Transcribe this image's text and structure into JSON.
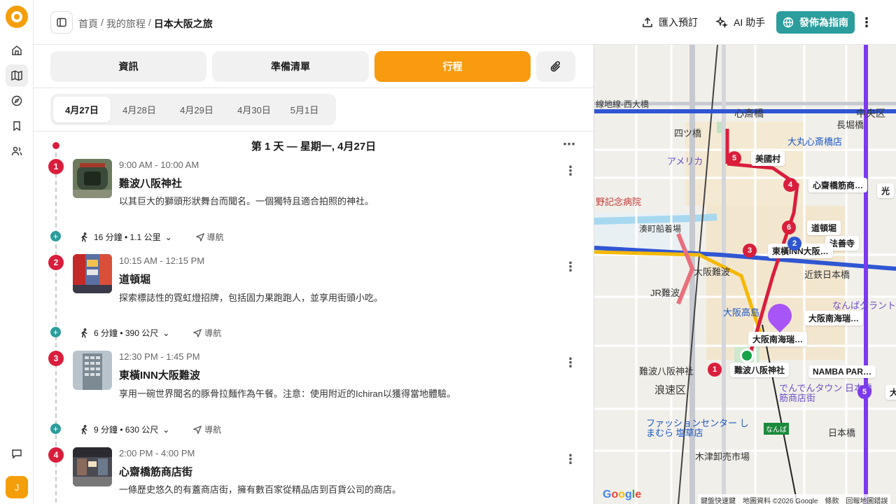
{
  "breadcrumb": {
    "home": "首頁",
    "sep1": "/",
    "trips": "我的旅程",
    "sep2": "/",
    "current": "日本大阪之旅"
  },
  "toolbar": {
    "import_label": "匯入預訂",
    "ai_label": "AI 助手",
    "publish_label": "發佈為指南"
  },
  "user": {
    "initial": "J"
  },
  "tabs": [
    {
      "label": "資訊"
    },
    {
      "label": "準備清單"
    },
    {
      "label": "行程"
    }
  ],
  "dates": [
    "4月27日",
    "4月28日",
    "4月29日",
    "4月30日",
    "5月1日"
  ],
  "day": {
    "title": "第 1 天 — 星期一, 4月27日"
  },
  "stops": [
    {
      "num": "1",
      "time": "9:00 AM - 10:00 AM",
      "name": "難波八阪神社",
      "desc": "以其巨大的獅頭形狀舞台而聞名。一個獨特且適合拍照的神社。"
    },
    {
      "num": "2",
      "time": "10:15 AM - 12:15 PM",
      "name": "道頓堀",
      "desc": "探索標誌性的霓虹燈招牌，包括固力果跑跑人，並享用街頭小吃。"
    },
    {
      "num": "3",
      "time": "12:30 PM - 1:45 PM",
      "name": "東橫INN大阪難波",
      "desc": "享用一碗世界聞名的豚骨拉麵作為午餐。注意：使用附近的Ichiran以獲得當地體驗。"
    },
    {
      "num": "4",
      "time": "2:00 PM - 4:00 PM",
      "name": "心齋橋筋商店街",
      "desc": "一條歷史悠久的有蓋商店街，擁有數百家從精品店到百貨公司的商店。"
    }
  ],
  "transits": [
    {
      "summary": "16 分鐘 • 1.1 公里",
      "nav": "導航"
    },
    {
      "summary": "6 分鐘 • 390 公尺",
      "nav": "導航"
    },
    {
      "summary": "9 分鐘 • 630 公尺",
      "nav": "導航"
    }
  ],
  "map": {
    "labels": {
      "shinsaibashi": "心斎橋",
      "chuo_ku": "中央区",
      "nagahoribashi": "長堀橋",
      "yotsubashi": "四ツ橋",
      "daimaru": "大丸心斎橋店",
      "americamura": "アメリカ",
      "hospital": "野記念病院",
      "minatomachi": "湊町船着場",
      "namba_station": "大阪難波",
      "jr_namba": "JR難波",
      "kintetsu": "近鉄日本橋",
      "namba_grand": "なんばグラント",
      "osaka_takashimaya": "大阪高島",
      "naniwa_ku": "浪速区",
      "namba_yasaka_shrine": "難波八阪神社",
      "shimamura": "ファッションセンター しまむら 塩草店",
      "kizu_market": "木津卸売市場",
      "nipponbashi": "日本橋",
      "den_den_town": "でんでんタウン 日本橋筋商店街",
      "namba_small": "なんば",
      "line_west": "線地線-西大橋"
    },
    "chips": {
      "bikokumura": "美國村",
      "shinsaibashisuji": "心齋橋筋商…",
      "hikari": "光",
      "dotonbori": "道頓堀",
      "hozenji": "法善寺",
      "toyoko_inn": "東橫INN大阪…",
      "swissotel": "大阪南海瑞…",
      "namba_parks": "NAMBA PAR…",
      "namba_shrine": "難波八阪神社",
      "nankai": "大阪南海瑞…",
      "daikoku": "大"
    },
    "pins": [
      "5",
      "4",
      "6",
      "2",
      "3",
      "1",
      "5"
    ],
    "attribution": {
      "shortcuts": "鍵盤快速鍵",
      "data": "地圖資料 ©2026 Google",
      "terms": "條款",
      "report": "回報地圖錯誤"
    },
    "google": "Google",
    "colors": {
      "route": "#d91e3c",
      "metro_blue": "#3056d3",
      "metro_purple": "#7c3aed",
      "pin_red": "#d91e3c",
      "pin_purple": "#7c3aed",
      "pin_green": "#16a34a"
    }
  }
}
